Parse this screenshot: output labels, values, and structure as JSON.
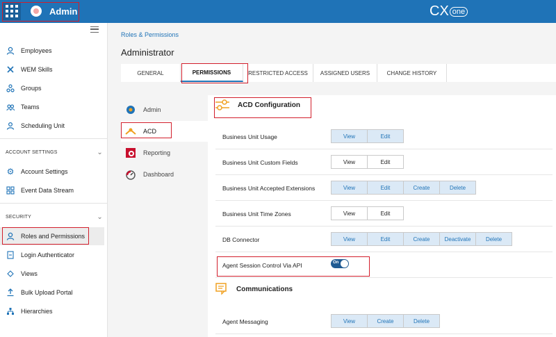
{
  "topbar": {
    "app_title": "Admin",
    "brand": "CX",
    "brand_suffix": "one"
  },
  "leftnav": {
    "items": [
      {
        "label": "Employees",
        "icon": "person-icon"
      },
      {
        "label": "WEM Skills",
        "icon": "tools-icon"
      },
      {
        "label": "Groups",
        "icon": "groups-icon"
      },
      {
        "label": "Teams",
        "icon": "teams-icon"
      },
      {
        "label": "Scheduling Unit",
        "icon": "scheduling-icon"
      }
    ],
    "account_settings_heading": "ACCOUNT SETTINGS",
    "account_items": [
      {
        "label": "Account Settings",
        "icon": "gear-icon"
      },
      {
        "label": "Event Data Stream",
        "icon": "stream-icon"
      }
    ],
    "security_heading": "SECURITY",
    "security_items": [
      {
        "label": "Roles and Permissions",
        "icon": "roles-icon"
      },
      {
        "label": "Login Authenticator",
        "icon": "login-icon"
      },
      {
        "label": "Views",
        "icon": "views-icon"
      },
      {
        "label": "Bulk Upload Portal",
        "icon": "upload-icon"
      },
      {
        "label": "Hierarchies",
        "icon": "hierarchy-icon"
      }
    ]
  },
  "main": {
    "breadcrumb": "Roles & Permissions",
    "title": "Administrator",
    "tabs": [
      "GENERAL",
      "PERMISSIONS",
      "RESTRICTED ACCESS",
      "ASSIGNED USERS",
      "CHANGE HISTORY"
    ],
    "active_tab": "PERMISSIONS"
  },
  "subnav": [
    {
      "label": "Admin"
    },
    {
      "label": "ACD"
    },
    {
      "label": "Reporting"
    },
    {
      "label": "Dashboard"
    }
  ],
  "acd": {
    "heading": "ACD Configuration",
    "rows": [
      {
        "label": "Business Unit Usage",
        "buttons": [
          {
            "label": "View",
            "on": true
          },
          {
            "label": "Edit",
            "on": true
          }
        ]
      },
      {
        "label": "Business Unit Custom Fields",
        "buttons": [
          {
            "label": "View",
            "on": false
          },
          {
            "label": "Edit",
            "on": false
          }
        ]
      },
      {
        "label": "Business Unit Accepted Extensions",
        "buttons": [
          {
            "label": "View",
            "on": true
          },
          {
            "label": "Edit",
            "on": true
          },
          {
            "label": "Create",
            "on": true
          },
          {
            "label": "Delete",
            "on": true
          }
        ]
      },
      {
        "label": "Business Unit Time Zones",
        "buttons": [
          {
            "label": "View",
            "on": false
          },
          {
            "label": "Edit",
            "on": false
          }
        ]
      },
      {
        "label": "DB Connector",
        "buttons": [
          {
            "label": "View",
            "on": true
          },
          {
            "label": "Edit",
            "on": true
          },
          {
            "label": "Create",
            "on": true
          },
          {
            "label": "Deactivate",
            "on": true
          },
          {
            "label": "Delete",
            "on": true
          }
        ]
      }
    ],
    "toggle_row": {
      "label": "Agent Session Control Via API",
      "toggle_text": "On",
      "value": true
    }
  },
  "communications": {
    "heading": "Communications",
    "rows": [
      {
        "label": "Agent Messaging",
        "buttons": [
          {
            "label": "View",
            "on": true
          },
          {
            "label": "Create",
            "on": true
          },
          {
            "label": "Delete",
            "on": true
          }
        ]
      }
    ]
  },
  "colors": {
    "accent": "#1f73b7",
    "highlight": "#d21e2b",
    "orange": "#f0a020"
  }
}
